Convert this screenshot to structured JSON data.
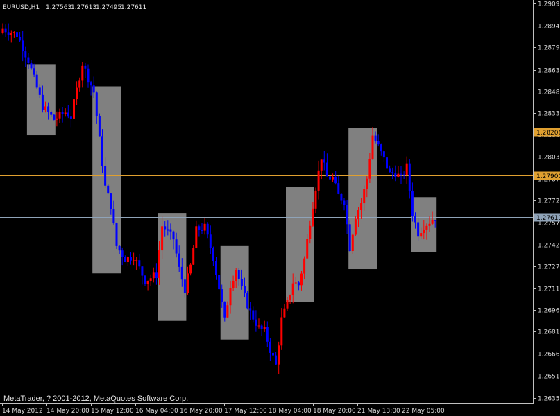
{
  "chart_data": {
    "type": "candlestick",
    "symbol_timeframe": "EURUSD,H1",
    "ohlc_header": [
      "1.27563",
      "1.27613",
      "1.27495",
      "1.27611"
    ],
    "copyright": "MetaTrader, ? 2001-2012, MetaQuotes Software Corp.",
    "ylim": [
      1.2632,
      1.2912
    ],
    "y_ticks": [
      "1.29095",
      "1.28940",
      "1.28790",
      "1.28635",
      "1.28485",
      "1.28335",
      "1.28185",
      "1.28030",
      "1.27875",
      "1.27725",
      "1.27575",
      "1.27420",
      "1.27270",
      "1.27115",
      "1.26965",
      "1.26815",
      "1.26660",
      "1.26510",
      "1.26355"
    ],
    "x_ticks": [
      "14 May 2012",
      "14 May 20:00",
      "15 May 12:00",
      "16 May 04:00",
      "16 May 20:00",
      "17 May 12:00",
      "18 May 04:00",
      "18 May 20:00",
      "21 May 13:00",
      "22 May 05:00"
    ],
    "bar_count": 153,
    "horizontal_levels": [
      {
        "label": "1.28206",
        "value": 1.28206,
        "color": "#e0a030"
      },
      {
        "label": "1.27900",
        "value": 1.279,
        "color": "#e0a030"
      },
      {
        "label": "1.27611",
        "value": 1.27611,
        "color": "#8fa3b8"
      }
    ],
    "current_price_label": "1.27611",
    "shaded_zones": [
      {
        "start_bar": 9,
        "end_bar": 18,
        "high": 1.2867,
        "low": 1.2818
      },
      {
        "start_bar": 32,
        "end_bar": 41,
        "high": 1.2852,
        "low": 1.2722
      },
      {
        "start_bar": 55,
        "end_bar": 64,
        "high": 1.2764,
        "low": 1.2689
      },
      {
        "start_bar": 77,
        "end_bar": 86,
        "high": 1.2741,
        "low": 1.2676
      },
      {
        "start_bar": 100,
        "end_bar": 109,
        "high": 1.2782,
        "low": 1.2702
      },
      {
        "start_bar": 122,
        "end_bar": 131,
        "high": 1.2823,
        "low": 1.2725
      },
      {
        "start_bar": 144,
        "end_bar": 152,
        "high": 1.2775,
        "low": 1.2737
      }
    ],
    "close_path": [
      [
        0,
        1.2892
      ],
      [
        5,
        1.2888
      ],
      [
        9,
        1.287
      ],
      [
        14,
        1.2838
      ],
      [
        18,
        1.2829
      ],
      [
        22,
        1.2834
      ],
      [
        24,
        1.2831
      ],
      [
        28,
        1.2868
      ],
      [
        32,
        1.2848
      ],
      [
        34,
        1.2815
      ],
      [
        36,
        1.2782
      ],
      [
        38,
        1.2769
      ],
      [
        40,
        1.2741
      ],
      [
        43,
        1.2732
      ],
      [
        46,
        1.2734
      ],
      [
        50,
        1.2717
      ],
      [
        54,
        1.2721
      ],
      [
        56,
        1.2755
      ],
      [
        60,
        1.2746
      ],
      [
        62,
        1.2725
      ],
      [
        64,
        1.2711
      ],
      [
        66,
        1.2727
      ],
      [
        68,
        1.2752
      ],
      [
        71,
        1.2754
      ],
      [
        74,
        1.2733
      ],
      [
        76,
        1.2712
      ],
      [
        78,
        1.2689
      ],
      [
        80,
        1.2714
      ],
      [
        82,
        1.2725
      ],
      [
        84,
        1.2711
      ],
      [
        87,
        1.2695
      ],
      [
        90,
        1.2684
      ],
      [
        92,
        1.2682
      ],
      [
        94,
        1.2669
      ],
      [
        96,
        1.2658
      ],
      [
        98,
        1.269
      ],
      [
        100,
        1.2701
      ],
      [
        102,
        1.2716
      ],
      [
        104,
        1.2714
      ],
      [
        106,
        1.2732
      ],
      [
        108,
        1.2758
      ],
      [
        110,
        1.2782
      ],
      [
        112,
        1.2803
      ],
      [
        114,
        1.2789
      ],
      [
        116,
        1.2788
      ],
      [
        118,
        1.2776
      ],
      [
        120,
        1.2772
      ],
      [
        122,
        1.274
      ],
      [
        124,
        1.2762
      ],
      [
        126,
        1.2771
      ],
      [
        128,
        1.2788
      ],
      [
        130,
        1.2818
      ],
      [
        132,
        1.281
      ],
      [
        134,
        1.2801
      ],
      [
        136,
        1.2791
      ],
      [
        138,
        1.2792
      ],
      [
        140,
        1.2788
      ],
      [
        142,
        1.2796
      ],
      [
        144,
        1.2764
      ],
      [
        146,
        1.275
      ],
      [
        148,
        1.2755
      ],
      [
        150,
        1.2758
      ],
      [
        152,
        1.2761
      ]
    ],
    "bull_color": "#ff0000",
    "bear_color": "#0000ff",
    "zone_color": "#808080",
    "grid": false
  }
}
